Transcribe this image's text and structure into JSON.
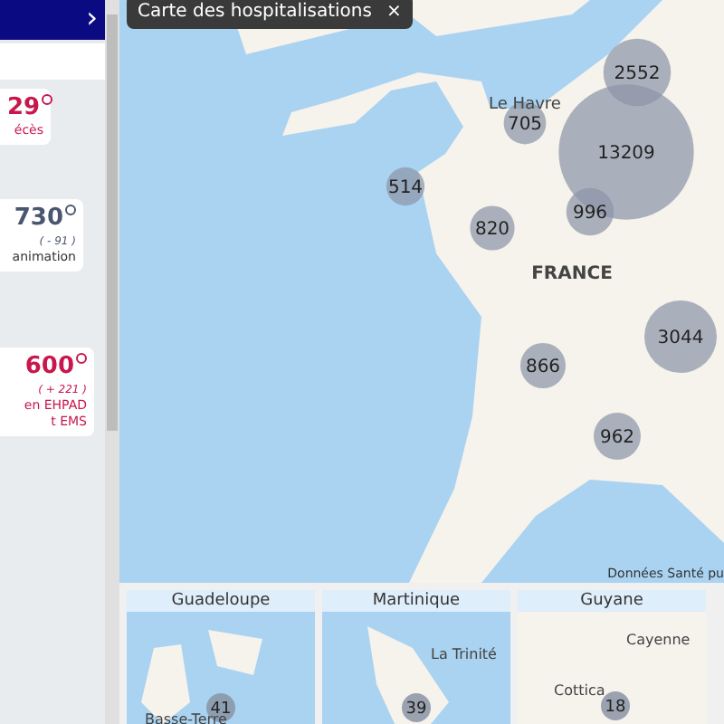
{
  "sidebar": {
    "header_chevron": "›",
    "cards": [
      {
        "value": "29",
        "lines": [
          "écès"
        ],
        "color": "#c8174d"
      },
      {
        "value": "730",
        "delta": "( - 91 )",
        "lines": [
          "animation"
        ],
        "color": "#4a5670"
      },
      {
        "value": "600",
        "delta": "( + 221 )",
        "lines": [
          "en EHPAD",
          "t EMS"
        ],
        "color": "#c8174d"
      }
    ]
  },
  "map": {
    "tooltip": "Carte des hospitalisations",
    "close": "×",
    "place_labels": [
      "Le Havre",
      "FRANCE"
    ],
    "clusters": [
      "2552",
      "705",
      "13209",
      "514",
      "820",
      "996",
      "3044",
      "866",
      "962"
    ],
    "attribution": "Données Santé pu"
  },
  "insets": [
    {
      "title": "Guadeloupe",
      "cluster": "41",
      "places": [
        "Basse-Terre"
      ]
    },
    {
      "title": "Martinique",
      "cluster": "39",
      "places": [
        "La Trinité"
      ]
    },
    {
      "title": "Guyane",
      "cluster": "18",
      "places": [
        "Cayenne",
        "Cottica"
      ]
    }
  ]
}
